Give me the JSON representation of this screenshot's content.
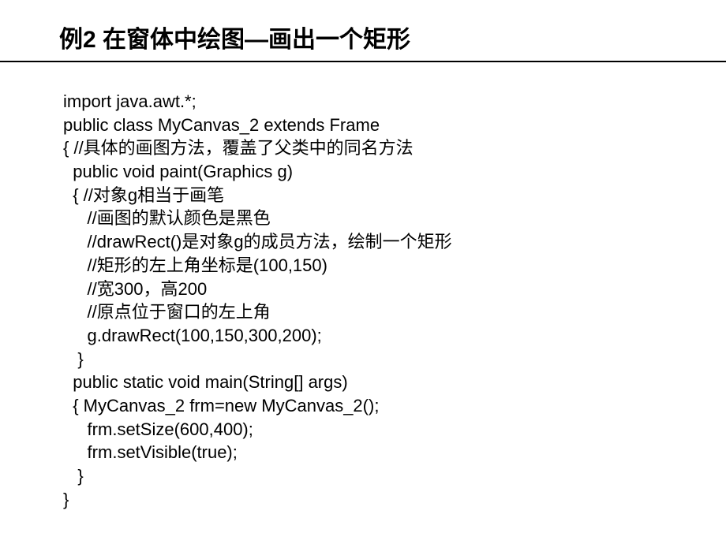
{
  "title": {
    "example_label": "例2",
    "text": "在窗体中绘图—画出一个矩形"
  },
  "code": {
    "lines": [
      "import java.awt.*;",
      "public class MyCanvas_2 extends Frame",
      "{ //具体的画图方法，覆盖了父类中的同名方法",
      "  public void paint(Graphics g)",
      "  { //对象g相当于画笔",
      "     //画图的默认颜色是黑色",
      "     //drawRect()是对象g的成员方法，绘制一个矩形",
      "     //矩形的左上角坐标是(100,150)",
      "     //宽300，高200",
      "     //原点位于窗口的左上角",
      "     g.drawRect(100,150,300,200);",
      "   }",
      "  public static void main(String[] args)",
      "  { MyCanvas_2 frm=new MyCanvas_2();",
      "     frm.setSize(600,400);",
      "     frm.setVisible(true);",
      "   }",
      "}"
    ]
  }
}
